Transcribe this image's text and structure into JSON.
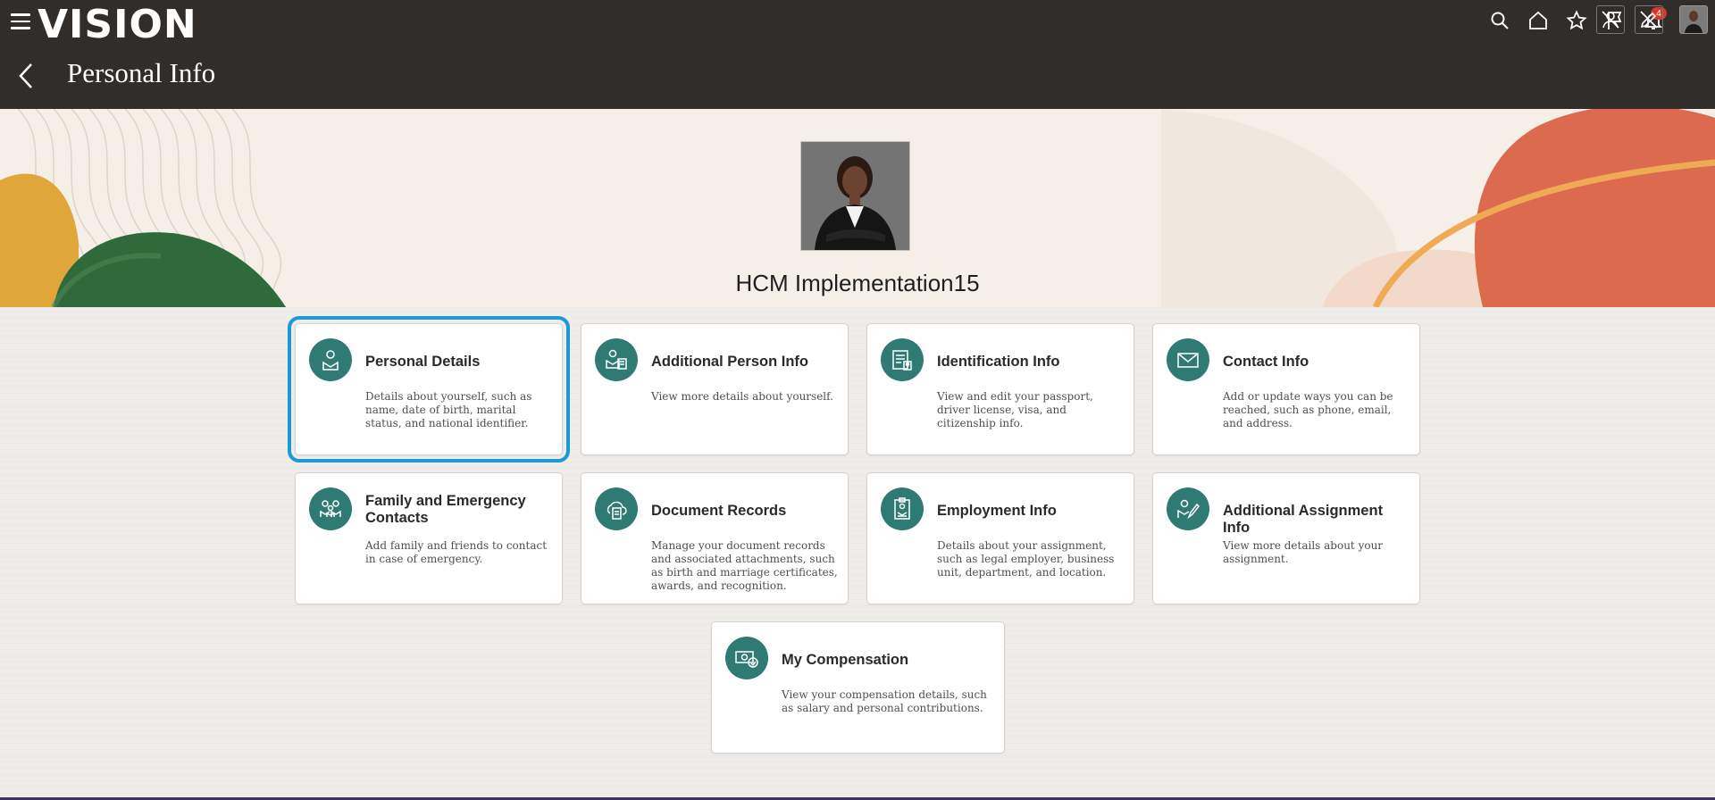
{
  "header": {
    "brand": "VISION",
    "page_title": "Personal Info",
    "notifications_count": "4",
    "icons": [
      "menu-icon",
      "search-icon",
      "home-icon",
      "star-icon",
      "flag-icon",
      "bell-icon",
      "person-icon",
      "edit-off-icon",
      "user-avatar"
    ]
  },
  "profile": {
    "name": "HCM Implementation15"
  },
  "tiles": [
    {
      "title": "Personal Details",
      "desc": "Details about yourself, such as name, date of birth, marital status, and national identifier.",
      "icon": "person-id-icon"
    },
    {
      "title": "Additional Person Info",
      "desc": "View more details about yourself.",
      "icon": "person-info-icon"
    },
    {
      "title": "Identification Info",
      "desc": "View and edit your passport, driver license, visa, and citizenship info.",
      "icon": "id-card-icon"
    },
    {
      "title": "Contact Info",
      "desc": "Add or update ways you can be reached, such as phone, email, and address.",
      "icon": "envelope-icon"
    },
    {
      "title": "Family and Emergency Contacts",
      "desc": "Add family and friends to contact in case of emergency.",
      "icon": "family-icon"
    },
    {
      "title": "Document Records",
      "desc": "Manage your document records and associated attachments, such as birth and marriage certificates, awards, and recognition.",
      "icon": "document-cloud-icon"
    },
    {
      "title": "Employment Info",
      "desc": "Details about your assignment, such as legal employer, business unit, department, and location.",
      "icon": "badge-icon"
    },
    {
      "title": "Additional Assignment Info",
      "desc": "View more details about your assignment.",
      "icon": "person-edit-icon"
    },
    {
      "title": "My Compensation",
      "desc": "View your compensation details, such as salary and personal contributions.",
      "icon": "money-icon"
    }
  ],
  "colors": {
    "header_bg": "#312d2a",
    "tile_icon_bg": "#2f7b73",
    "selection": "#1a9ad6",
    "badge": "#d33a2c"
  }
}
